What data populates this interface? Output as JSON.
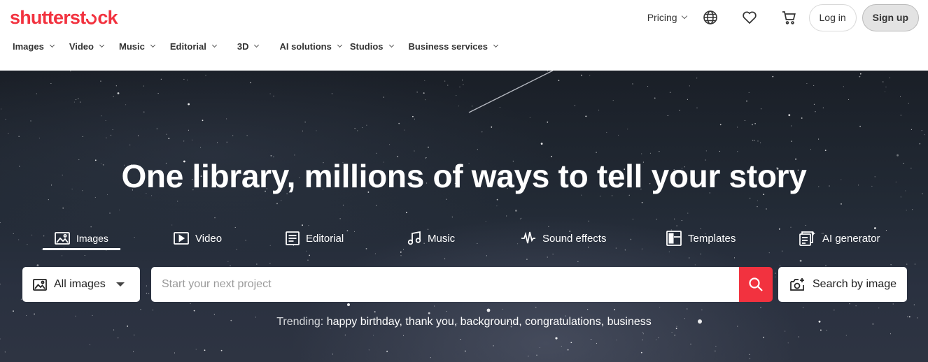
{
  "brand": {
    "logo_before": "shutterst",
    "logo_after": "ck",
    "accent_color": "#f2323f"
  },
  "header": {
    "pricing_label": "Pricing",
    "icons": [
      "globe-icon",
      "heart-icon",
      "cart-icon"
    ],
    "login_label": "Log in",
    "signup_label": "Sign up"
  },
  "nav": {
    "items": [
      {
        "label": "Images"
      },
      {
        "label": "Video"
      },
      {
        "label": "Music"
      },
      {
        "label": "Editorial"
      },
      {
        "label": "3D"
      },
      {
        "label": "AI solutions"
      },
      {
        "label": "Studios"
      },
      {
        "label": "Business services"
      }
    ]
  },
  "hero": {
    "headline": "One library, millions of ways to tell your story",
    "tabs": [
      {
        "label": "Images",
        "icon": "image-icon",
        "active": true
      },
      {
        "label": "Video",
        "icon": "video-icon"
      },
      {
        "label": "Editorial",
        "icon": "editorial-icon"
      },
      {
        "label": "Music",
        "icon": "music-note-icon"
      },
      {
        "label": "Sound effects",
        "icon": "waveform-icon"
      },
      {
        "label": "Templates",
        "icon": "template-icon"
      },
      {
        "label": "AI generator",
        "icon": "ai-generator-icon"
      }
    ]
  },
  "search": {
    "type_selected": "All images",
    "placeholder": "Start your next project",
    "value": "",
    "search_by_image_label": "Search by image"
  },
  "trending": {
    "label": "Trending:",
    "terms": [
      "happy birthday,",
      "thank you,",
      "background,",
      "congratulations,",
      "business"
    ]
  }
}
